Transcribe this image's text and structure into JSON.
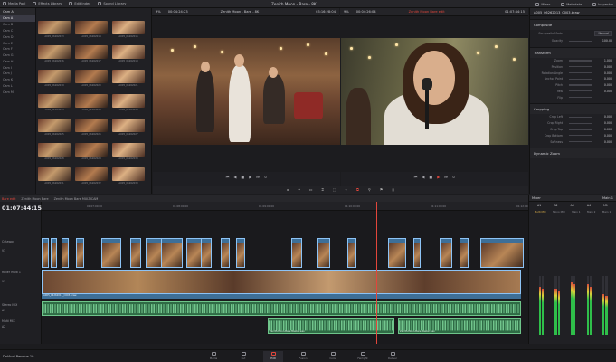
{
  "topbar": {
    "left": [
      "Media Pool",
      "Effects Library",
      "Edit Index",
      "Sound Library"
    ],
    "title": "Zenith Moon - Bare - 8K",
    "right": [
      "Mixer",
      "Metadata",
      "Inspector"
    ]
  },
  "media_pool": {
    "tree_header": "Cam A",
    "tree_items": [
      "Cam A",
      "Cam B",
      "Cam C",
      "Cam D",
      "Cam E",
      "Cam F",
      "Cam G",
      "Cam H",
      "Cam I",
      "Cam J",
      "Cam K",
      "Cam L",
      "Cam M"
    ],
    "clips": [
      "A005_06262013",
      "A005_06262014",
      "A005_06262015",
      "A005_06262016",
      "A005_06262017",
      "A005_06262018",
      "A005_06262019",
      "A005_06262020",
      "A005_06262021",
      "A005_06262022",
      "A005_06262023",
      "A005_06262024",
      "A005_06262025",
      "A005_06262026",
      "A005_06262027",
      "A005_06262028",
      "A005_06262029",
      "A005_06262030",
      "A005_06262031",
      "A005_06262032",
      "A005_06262033"
    ]
  },
  "source_viewer": {
    "zoom": "9%",
    "timecode": "00:04:24:23",
    "title": "Zenith Moon - Bare - 8K",
    "duration": "03:16:28:04"
  },
  "program_viewer": {
    "zoom": "9%",
    "timecode": "00:04:26:04",
    "title": "Zenith Moon Bare edit",
    "current": "01:07:44:15"
  },
  "toolbar": {
    "tools": [
      "▸",
      "⌖",
      "▭",
      "⌗",
      "⬚",
      "⌁",
      "⧉",
      "⚲",
      "⚑",
      "▮"
    ]
  },
  "inspector": {
    "header": "A005_06262013_C003.braw",
    "sections": [
      {
        "title": "Composite",
        "rows": [
          {
            "label": "Composite Mode",
            "value": "Normal"
          },
          {
            "label": "Opacity",
            "value": "100.00"
          }
        ]
      },
      {
        "title": "Transform",
        "rows": [
          {
            "label": "Zoom",
            "value": "1.000"
          },
          {
            "label": "Position",
            "value": "0.000"
          },
          {
            "label": "Rotation Angle",
            "value": "0.000"
          },
          {
            "label": "Anchor Point",
            "value": "0.000"
          },
          {
            "label": "Pitch",
            "value": "0.000"
          },
          {
            "label": "Yaw",
            "value": "0.000"
          },
          {
            "label": "Flip",
            "value": ""
          }
        ]
      },
      {
        "title": "Cropping",
        "rows": [
          {
            "label": "Crop Left",
            "value": "0.000"
          },
          {
            "label": "Crop Right",
            "value": "0.000"
          },
          {
            "label": "Crop Top",
            "value": "0.000"
          },
          {
            "label": "Crop Bottom",
            "value": "0.000"
          },
          {
            "label": "Softness",
            "value": "0.000"
          }
        ]
      },
      {
        "title": "Dynamic Zoom",
        "rows": []
      }
    ]
  },
  "timeline": {
    "tabs": [
      "Bare edit",
      "Zenith Moon Bare",
      "Zenith Moon Bare MULTICAM"
    ],
    "timecode": "01:07:44:15",
    "ruler": [
      "01:07:00:00",
      "01:08:00:00",
      "01:09:00:00",
      "01:10:00:00",
      "01:11:00:00",
      "01:12:00:00"
    ],
    "tracks": [
      {
        "name": "Cutaway",
        "code": "V3"
      },
      {
        "name": "Roller Multi 1",
        "code": "V1"
      },
      {
        "name": "Stereo MIX",
        "code": "A1"
      },
      {
        "name": "Multi MIX",
        "code": "A2"
      }
    ],
    "v1_title": "A005_06262013_C003.braw",
    "audio_title": "Zenith-Moon-Bare-Master.wav"
  },
  "mixer": {
    "title": "Mixer",
    "master": "Main 1",
    "channels": [
      "A1",
      "A2",
      "A3",
      "A4",
      "M1"
    ],
    "channel_labels": [
      "Multi MIX",
      "Mono MIX",
      "Main 1",
      "Main 2",
      "Main 1"
    ],
    "levels": [
      0.82,
      0.78,
      0.9,
      0.86,
      0.7
    ]
  },
  "pages": [
    "Media",
    "Cut",
    "Edit",
    "Fusion",
    "Color",
    "Fairlight",
    "Deliver"
  ],
  "active_page": "Edit",
  "brand": "DaVinci Resolve 19",
  "colors": {
    "accent": "#e2463b",
    "video_clip": "#3d6f98",
    "audio_clip": "#2f6b45"
  }
}
